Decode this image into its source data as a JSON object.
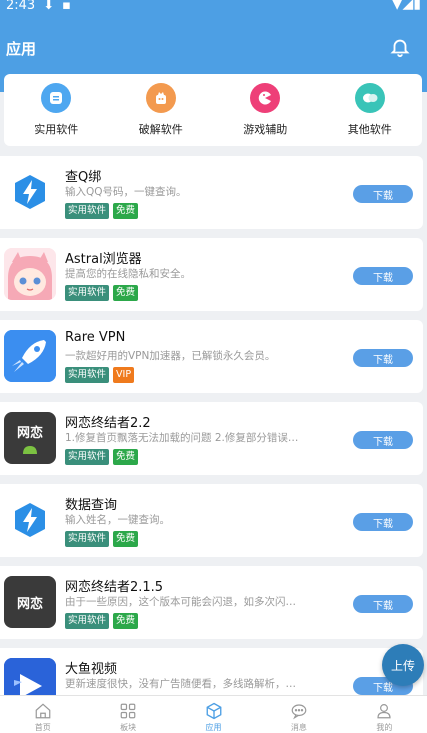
{
  "status": {
    "time": "2:43"
  },
  "header": {
    "title": "应用"
  },
  "categories": [
    {
      "label": "实用软件",
      "icon": "tool-app-icon",
      "color": "#4ea7f0"
    },
    {
      "label": "破解软件",
      "icon": "gift-box-icon",
      "color": "#f39a4f"
    },
    {
      "label": "游戏辅助",
      "icon": "pacman-icon",
      "color": "#ee3f78"
    },
    {
      "label": "其他软件",
      "icon": "chat-bubbles-icon",
      "color": "#39c4b8"
    }
  ],
  "apps": [
    {
      "name": "查Q绑",
      "desc": "输入QQ号码，一键查询。",
      "type_tag": "实用软件",
      "price_tag": "免费",
      "download": "下载"
    },
    {
      "name": "Astral浏览器",
      "desc": "提高您的在线隐私和安全。",
      "type_tag": "实用软件",
      "price_tag": "免费",
      "download": "下载"
    },
    {
      "name": "Rare VPN",
      "desc": "一款超好用的VPN加速器，已解锁永久会员。",
      "type_tag": "实用软件",
      "price_tag": "VIP",
      "download": "下载"
    },
    {
      "name": "网恋终结者2.2",
      "desc": "1.修复首页飘落无法加载的问题 2.修复部分错误…",
      "type_tag": "实用软件",
      "price_tag": "免费",
      "download": "下载",
      "icon_text": "网恋"
    },
    {
      "name": "数据查询",
      "desc": "输入姓名，一键查询。",
      "type_tag": "实用软件",
      "price_tag": "免费",
      "download": "下载"
    },
    {
      "name": "网恋终结者2.1.5",
      "desc": "由于一些原因，这个版本可能会闪退，如多次闪…",
      "type_tag": "实用软件",
      "price_tag": "免费",
      "download": "下载",
      "icon_text": "网恋"
    },
    {
      "name": "大鱼视频",
      "desc": "更新速度很快，没有广告随便看，多线路解析，…",
      "type_tag": "",
      "price_tag": "",
      "download": "下载"
    }
  ],
  "upload_label": "上传",
  "tabs": [
    {
      "label": "首页"
    },
    {
      "label": "板块"
    },
    {
      "label": "应用"
    },
    {
      "label": "消息"
    },
    {
      "label": "我的"
    }
  ]
}
